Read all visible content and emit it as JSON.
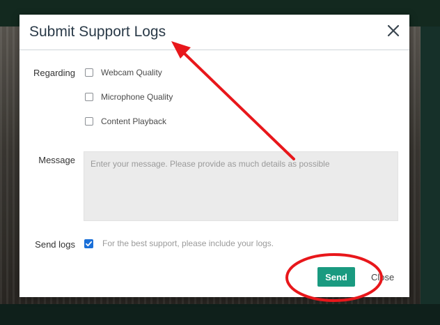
{
  "dialog": {
    "title": "Submit Support Logs"
  },
  "form": {
    "regarding_label": "Regarding",
    "options": [
      {
        "label": "Webcam Quality",
        "checked": false
      },
      {
        "label": "Microphone Quality",
        "checked": false
      },
      {
        "label": "Content Playback",
        "checked": false
      }
    ],
    "message_label": "Message",
    "message_placeholder": "Enter your message. Please provide as much details as possible",
    "message_value": "",
    "send_logs_label": "Send logs",
    "send_logs_checked": true,
    "send_logs_hint": "For the best support, please include your logs."
  },
  "actions": {
    "send_label": "Send",
    "close_label": "Close"
  },
  "icons": {
    "close": "close-icon",
    "check": "check-icon"
  },
  "colors": {
    "send_button": "#1a9a80",
    "checkbox_checked": "#1a6fd8",
    "annotation": "#e8171b"
  }
}
